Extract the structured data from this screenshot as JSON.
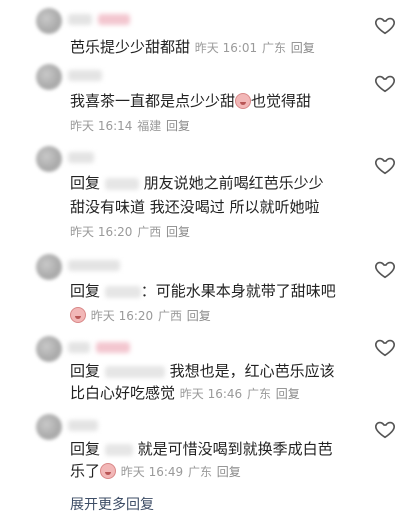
{
  "comments": [
    {
      "text": "芭乐提少少甜都甜",
      "time": "昨天 16:01",
      "location": "广东",
      "reply": "回复"
    },
    {
      "text": "我喜茶一直都是点少少甜",
      "text_tail": "也觉得甜",
      "time": "昨天 16:14",
      "location": "福建",
      "reply": "回复"
    },
    {
      "prefix": "回复",
      "line1": "朋友说她之前喝红芭乐少少",
      "line2": "甜没有味道 我还没喝过 所以就听她啦",
      "time": "昨天 16:20",
      "location": "广西",
      "reply": "回复"
    },
    {
      "prefix": "回复",
      "text": "：可能水果本身就带了甜味吧",
      "time": "昨天 16:20",
      "location": "广西",
      "reply": "回复"
    },
    {
      "prefix": "回复",
      "line1": "我想也是，红心芭乐应该",
      "line2": "比白心好吃感觉",
      "time": "昨天 16:46",
      "location": "广东",
      "reply": "回复"
    },
    {
      "prefix": "回复",
      "line1": "就是可惜没喝到就换季成白芭",
      "line2": "乐了",
      "time": "昨天 16:49",
      "location": "广东",
      "reply": "回复"
    }
  ],
  "show_more": "展开更多回复",
  "colors": {
    "text": "#222222",
    "meta": "#9a9a9a",
    "link": "#3d4d66",
    "heart_stroke": "#555555"
  },
  "icons": {
    "like": "heart-outline-icon",
    "emoji": "blush-emoji-icon"
  }
}
